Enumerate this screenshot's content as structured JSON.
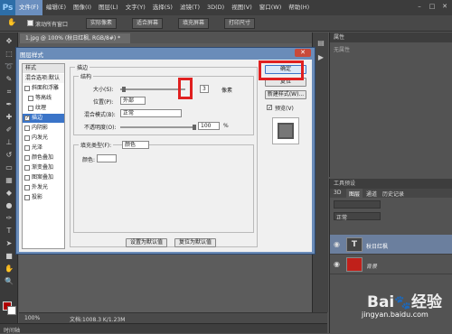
{
  "menubar": {
    "logo": "Ps",
    "items": [
      "文件(F)",
      "编辑(E)",
      "图像(I)",
      "图层(L)",
      "文字(Y)",
      "选择(S)",
      "滤镜(T)",
      "3D(D)",
      "视图(V)",
      "窗口(W)",
      "帮助(H)"
    ],
    "active_index": 0
  },
  "optionsbar": {
    "buttons": [
      "实际像素",
      "适合屏幕",
      "填充屏幕",
      "打印尺寸"
    ],
    "check_label": "滚动所有窗口"
  },
  "document": {
    "tab_title": "1.jpg @ 100% (秋日红枫, RGB/8#) *",
    "zoom": "100%",
    "status": "文档:1008.3 K/1.23M",
    "timeline": "时间轴"
  },
  "properties_panel": {
    "title": "属性",
    "content": "无属性"
  },
  "layers_panel": {
    "title": "工具预设",
    "tabs": [
      "3D",
      "图层",
      "通道",
      "历史记录"
    ],
    "blend_mode": "正常",
    "layers": [
      {
        "name": "秋日红枫",
        "thumb": "T"
      },
      {
        "name": "背景",
        "thumb": ""
      }
    ]
  },
  "dialog": {
    "title": "图层样式",
    "styles_header": "样式",
    "blend_options": "混合选项:默认",
    "style_items": [
      {
        "label": "斜面和浮雕",
        "checked": false,
        "indent": false
      },
      {
        "label": "等高线",
        "checked": false,
        "indent": true
      },
      {
        "label": "纹理",
        "checked": false,
        "indent": true
      },
      {
        "label": "描边",
        "checked": true,
        "indent": false
      },
      {
        "label": "内阴影",
        "checked": false,
        "indent": false
      },
      {
        "label": "内发光",
        "checked": false,
        "indent": false
      },
      {
        "label": "光泽",
        "checked": false,
        "indent": false
      },
      {
        "label": "颜色叠加",
        "checked": false,
        "indent": false
      },
      {
        "label": "渐变叠加",
        "checked": false,
        "indent": false
      },
      {
        "label": "图案叠加",
        "checked": false,
        "indent": false
      },
      {
        "label": "外发光",
        "checked": false,
        "indent": false
      },
      {
        "label": "投影",
        "checked": false,
        "indent": false
      }
    ],
    "selected_index": 3,
    "stroke_title": "描边",
    "structure_title": "结构",
    "size_label": "大小(S):",
    "size_value": "3",
    "size_unit": "像素",
    "position_label": "位置(P):",
    "position_value": "外部",
    "blend_mode_label": "混合模式(B):",
    "blend_mode_value": "正常",
    "opacity_label": "不透明度(O):",
    "opacity_value": "100",
    "opacity_unit": "%",
    "fill_type_label": "填充类型(F):",
    "fill_type_value": "颜色",
    "color_label": "颜色:",
    "set_default": "设置为默认值",
    "reset_default": "复位为默认值",
    "ok": "确定",
    "reset": "复位",
    "new_style": "新建样式(W)...",
    "preview": "预览(V)"
  },
  "watermark": {
    "brand": "Bai",
    "brand2": "经验",
    "url": "jingyan.baidu.com"
  },
  "colors": {
    "highlight": "#e02020",
    "foreground": "#b00000",
    "selected": "#3a74c8"
  }
}
